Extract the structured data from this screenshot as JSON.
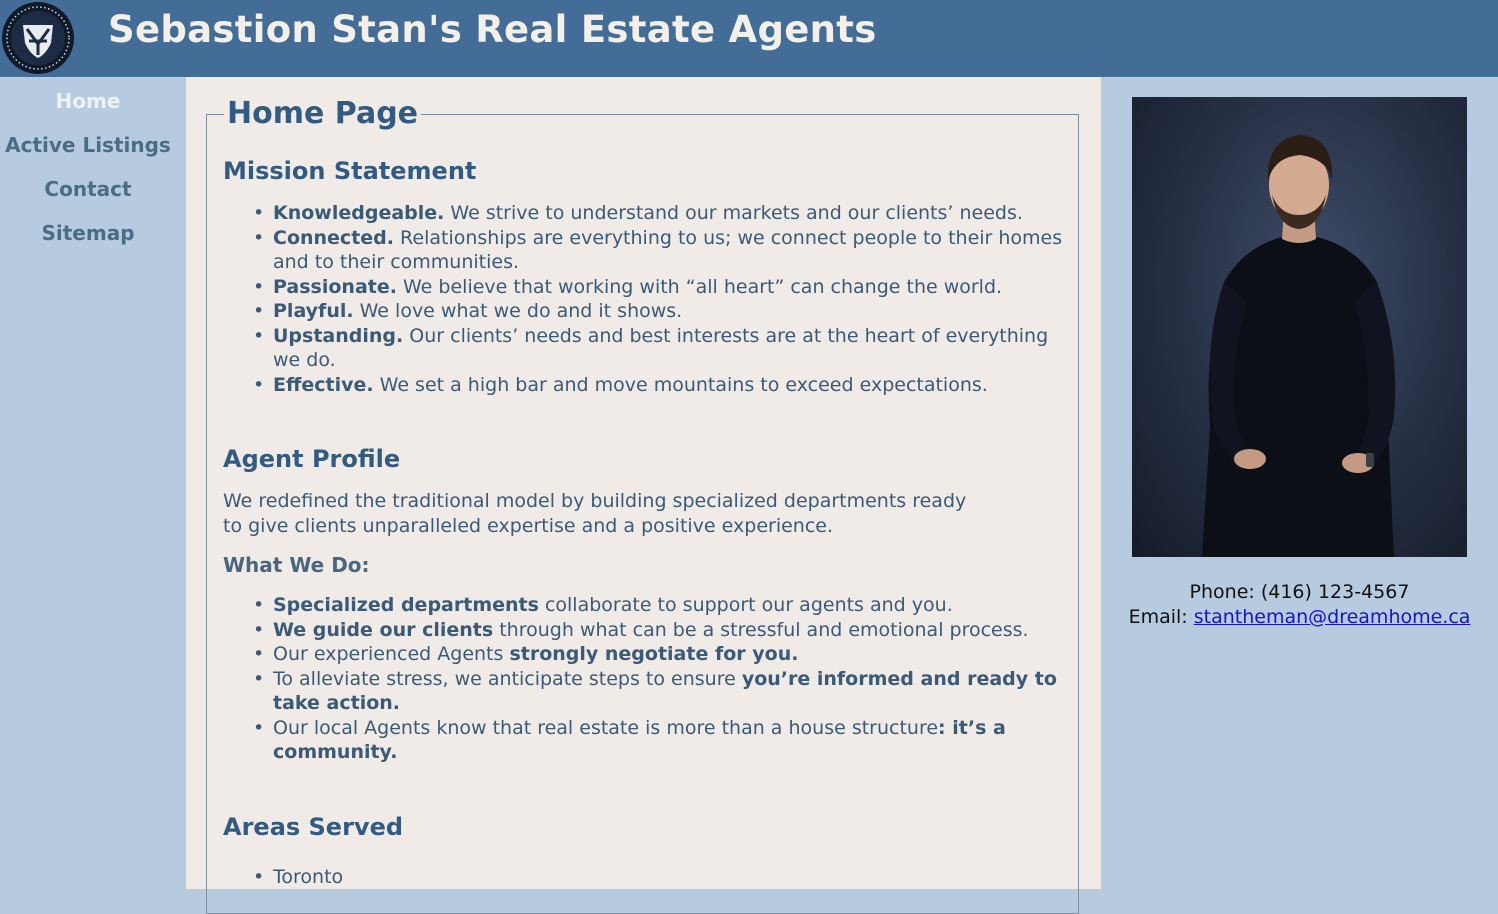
{
  "header": {
    "title": "Sebastion Stan's Real Estate Agents",
    "logo_icon": "shield-eagle-logo-icon"
  },
  "nav": {
    "items": [
      {
        "label": "Home",
        "active": true
      },
      {
        "label": "Active Listings",
        "active": false
      },
      {
        "label": "Contact",
        "active": false
      },
      {
        "label": "Sitemap",
        "active": false
      }
    ]
  },
  "main": {
    "page_title": "Home Page",
    "mission": {
      "heading": "Mission Statement",
      "items": [
        {
          "bold": "Knowledgeable.",
          "text": " We strive to understand our markets and our clients’ needs."
        },
        {
          "bold": "Connected.",
          "text": " Relationships are everything to us; we connect people to their homes and to their communities."
        },
        {
          "bold": "Passionate.",
          "text": " We believe that working with “all heart” can change the world."
        },
        {
          "bold": "Playful.",
          "text": " We love what we do and it shows."
        },
        {
          "bold": "Upstanding.",
          "text": " Our clients’ needs and best interests are at the heart of everything we do."
        },
        {
          "bold": "Effective.",
          "text": " We set a high bar and move mountains to exceed expectations."
        }
      ]
    },
    "profile": {
      "heading": "Agent Profile",
      "paragraph": "We redefined the traditional model by building specialized departments ready to give clients unparalleled expertise and a positive experience."
    },
    "what_we_do": {
      "heading": "What We Do:",
      "items": [
        {
          "pre": "",
          "bold": "Specialized departments",
          "post": " collaborate to support our agents and you."
        },
        {
          "pre": "",
          "bold": "We guide our clients",
          "post": " through what can be a stressful and emotional process."
        },
        {
          "pre": "Our experienced Agents ",
          "bold": "strongly negotiate for you.",
          "post": ""
        },
        {
          "pre": "To alleviate stress, we anticipate steps to ensure ",
          "bold": "you’re informed and ready to take action.",
          "post": ""
        },
        {
          "pre": "Our local Agents know that real estate is more than a house structure",
          "bold": ": it’s a community.",
          "post": ""
        }
      ]
    },
    "areas": {
      "heading": "Areas Served",
      "items": [
        "Toronto"
      ]
    }
  },
  "aside": {
    "photo_alt": "Agent portrait",
    "phone_label": "Phone:",
    "phone": "(416) 123-4567",
    "email_label": "Email:",
    "email": "stantheman@dreamhome.ca"
  },
  "colors": {
    "header_bg": "#436d97",
    "page_bg": "#b7cbe0",
    "content_bg": "#f0ebe7",
    "heading": "#335a80",
    "link": "#1515c8"
  }
}
